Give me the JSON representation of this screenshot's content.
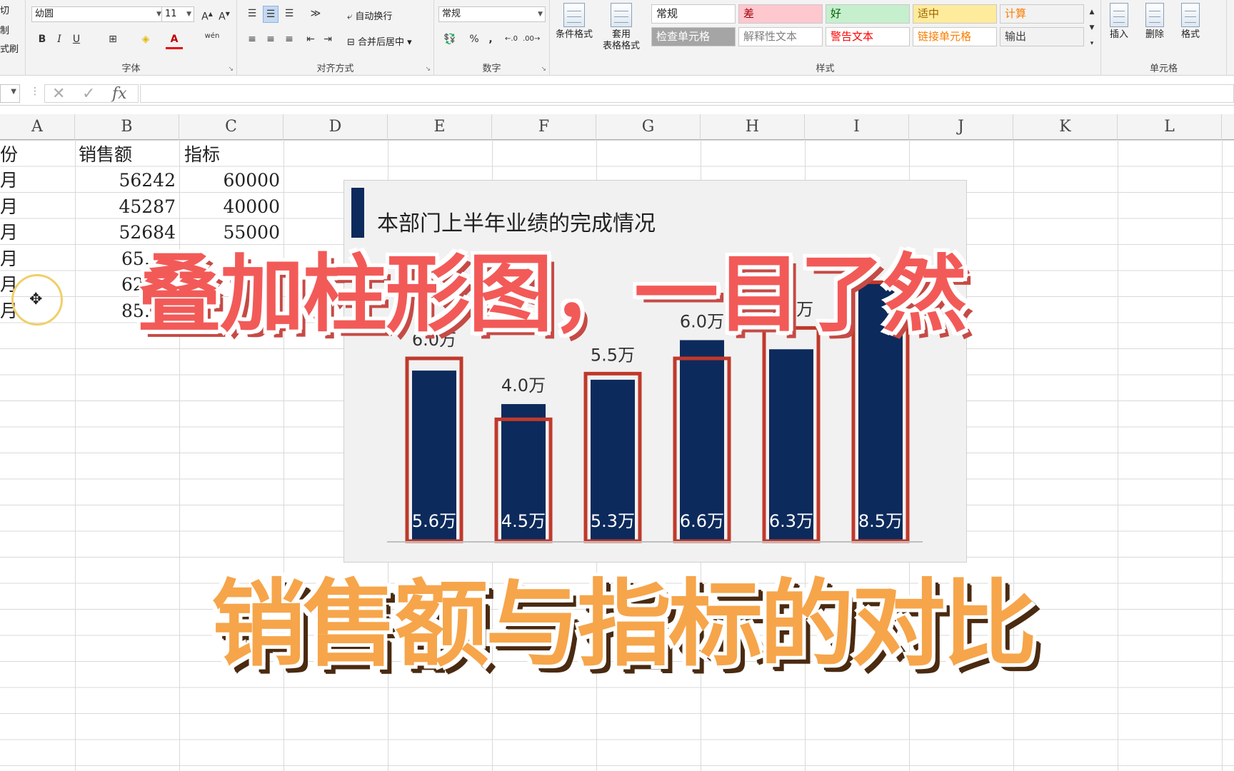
{
  "ribbon": {
    "clipboard": {
      "cut": "切",
      "copy": "制",
      "painter": "式刷"
    },
    "font": {
      "name": "幼圆",
      "size": "11",
      "group_label": "字体",
      "bold": "B",
      "italic": "I",
      "underline": "U",
      "phonetic": "wén"
    },
    "alignment": {
      "wrap_text": "自动换行",
      "merge_center": "合并后居中",
      "group_label": "对齐方式"
    },
    "number": {
      "format": "常规",
      "percent": "%",
      "comma": ",",
      "group_label": "数字"
    },
    "styles": {
      "conditional_format": "条件格式",
      "format_as_table_1": "套用",
      "format_as_table_2": "表格格式",
      "group_label": "样式",
      "cells": [
        {
          "label": "常规",
          "bg": "#ffffff",
          "fg": "#222222"
        },
        {
          "label": "差",
          "bg": "#ffc7ce",
          "fg": "#9c0006"
        },
        {
          "label": "好",
          "bg": "#c6efce",
          "fg": "#006100"
        },
        {
          "label": "适中",
          "bg": "#ffeb9c",
          "fg": "#9c6500"
        },
        {
          "label": "计算",
          "bg": "#f2f2f2",
          "fg": "#fa7d00"
        },
        {
          "label": "检查单元格",
          "bg": "#a5a5a5",
          "fg": "#ffffff"
        },
        {
          "label": "解释性文本",
          "bg": "#ffffff",
          "fg": "#7f7f7f"
        },
        {
          "label": "警告文本",
          "bg": "#ffffff",
          "fg": "#ff0000"
        },
        {
          "label": "链接单元格",
          "bg": "#ffffff",
          "fg": "#fa7d00"
        },
        {
          "label": "输出",
          "bg": "#f2f2f2",
          "fg": "#3f3f3f"
        }
      ]
    },
    "cells_group": {
      "insert": "插入",
      "delete": "删除",
      "format": "格式",
      "group_label": "单元格"
    }
  },
  "formula_bar": {
    "fx": "fx",
    "cancel": "✕",
    "enter": "✓"
  },
  "columns": [
    "A",
    "B",
    "C",
    "D",
    "E",
    "F",
    "G",
    "H",
    "I",
    "J",
    "K",
    "L"
  ],
  "sheet": {
    "header": {
      "a": "份",
      "b": "销售额",
      "c": "指标"
    },
    "rows": [
      {
        "a": "月",
        "b": "56242",
        "c": "60000"
      },
      {
        "a": "月",
        "b": "45287",
        "c": "40000"
      },
      {
        "a": "月",
        "b": "52684",
        "c": "55000"
      },
      {
        "a": "月",
        "b": "65…",
        "c": ""
      },
      {
        "a": "月",
        "b": "62…",
        "c": ""
      },
      {
        "a": "月",
        "b": "85…",
        "c": ""
      }
    ]
  },
  "chart_data": {
    "type": "bar",
    "title": "本部门上半年业绩的完成情况",
    "categories": [
      "",
      "",
      "",
      "",
      "",
      ""
    ],
    "series": [
      {
        "name": "销售额",
        "values": [
          5.6,
          4.5,
          5.3,
          6.6,
          6.3,
          8.5
        ],
        "labels": [
          "5.6万",
          "4.5万",
          "5.3万",
          "6.6万",
          "6.3万",
          "8.5万"
        ],
        "color": "#0d2a5c"
      },
      {
        "name": "指标",
        "values": [
          6.0,
          4.0,
          5.5,
          6.0,
          7.0,
          8.5
        ],
        "labels": [
          "6.0万",
          "4.0万",
          "5.5万",
          "6.0万",
          "7.0万",
          ""
        ],
        "color": "#c0392b"
      }
    ],
    "ylim": [
      0,
      10
    ],
    "grid": false,
    "accent": "#0d2a5c"
  },
  "overlay": {
    "title": "叠加柱形图，一目了然",
    "subtitle": "销售额与指标的对比"
  }
}
